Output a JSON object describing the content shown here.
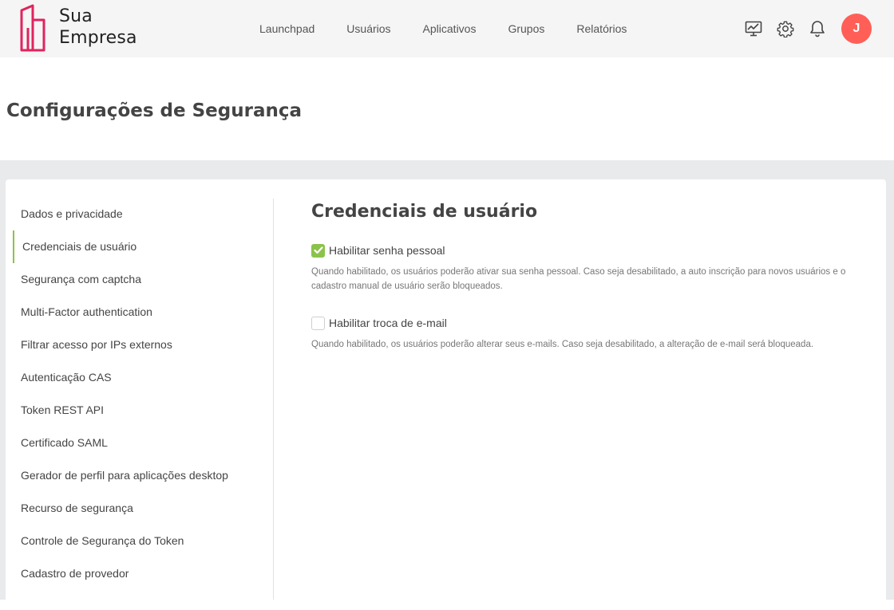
{
  "brand": {
    "name_line1": "Sua",
    "name_line2": "Empresa",
    "accent_color": "#e0245e",
    "logo_icon": "building-logo-icon"
  },
  "nav": {
    "items": [
      {
        "label": "Launchpad"
      },
      {
        "label": "Usuários"
      },
      {
        "label": "Aplicativos"
      },
      {
        "label": "Grupos"
      },
      {
        "label": "Relatórios"
      }
    ]
  },
  "header_icons": {
    "monitor": "monitor-chart-icon",
    "settings": "gear-icon",
    "notifications": "bell-icon"
  },
  "user": {
    "avatar_initial": "J",
    "avatar_color": "#ff5f57"
  },
  "page": {
    "title": "Configurações de Segurança"
  },
  "sidebar": {
    "active_color": "#8bc34a",
    "items": [
      {
        "label": "Dados e privacidade",
        "active": false
      },
      {
        "label": "Credenciais de usuário",
        "active": true
      },
      {
        "label": "Segurança com captcha",
        "active": false
      },
      {
        "label": "Multi-Factor authentication",
        "active": false
      },
      {
        "label": "Filtrar acesso por IPs externos",
        "active": false
      },
      {
        "label": "Autenticação CAS",
        "active": false
      },
      {
        "label": "Token REST API",
        "active": false
      },
      {
        "label": "Certificado SAML",
        "active": false
      },
      {
        "label": "Gerador de perfil para aplicações desktop",
        "active": false
      },
      {
        "label": "Recurso de segurança",
        "active": false
      },
      {
        "label": "Controle de Segurança do Token",
        "active": false
      },
      {
        "label": "Cadastro de provedor",
        "active": false
      }
    ]
  },
  "main": {
    "section_title": "Credenciais de usuário",
    "options": [
      {
        "label": "Habilitar senha pessoal",
        "checked": true,
        "description": "Quando habilitado, os usuários poderão ativar sua senha pessoal. Caso seja desabilitado, a auto inscrição para novos usuários e o cadastro manual de usuário serão bloqueados."
      },
      {
        "label": "Habilitar troca de e-mail",
        "checked": false,
        "description": "Quando habilitado, os usuários poderão alterar seus e-mails. Caso seja desabilitado, a alteração de e-mail será bloqueada."
      }
    ]
  }
}
